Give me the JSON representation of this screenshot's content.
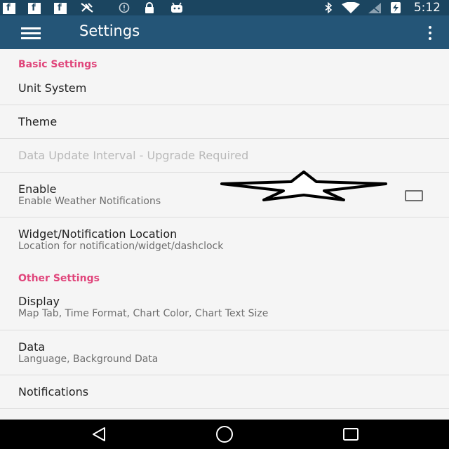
{
  "status_bar": {
    "time": "5:12",
    "facebook_glyph": "f",
    "left_icons": [
      "facebook-icon",
      "facebook-icon",
      "facebook-icon",
      "no-tools-icon",
      "info-circle-icon",
      "lock-icon",
      "android-icon"
    ],
    "right_icons": [
      "bluetooth-icon",
      "wifi-icon",
      "signal-icon",
      "battery-charging-icon"
    ]
  },
  "app_bar": {
    "title": "Settings",
    "color": "#245577"
  },
  "sections": {
    "basic_header": "Basic Settings",
    "other_header": "Other Settings"
  },
  "prefs": {
    "unit_system": {
      "title": "Unit System"
    },
    "theme": {
      "title": "Theme"
    },
    "data_update": {
      "title": "Data Update Interval - Upgrade Required"
    },
    "enable": {
      "title": "Enable",
      "summary": "Enable Weather Notifications",
      "checked": false
    },
    "widget_location": {
      "title": "Widget/Notification Location",
      "summary": "Location for notification/widget/dashclock"
    },
    "display": {
      "title": "Display",
      "summary": "Map Tab, Time Format, Chart Color, Chart Text Size"
    },
    "data": {
      "title": "Data",
      "summary": "Language, Background Data"
    },
    "notifications": {
      "title": "Notifications"
    }
  },
  "nav_bar": {
    "buttons": [
      "back-icon",
      "home-icon",
      "recents-icon"
    ]
  },
  "colors": {
    "accent": "#e0457b",
    "status_bar": "#1b4560"
  }
}
